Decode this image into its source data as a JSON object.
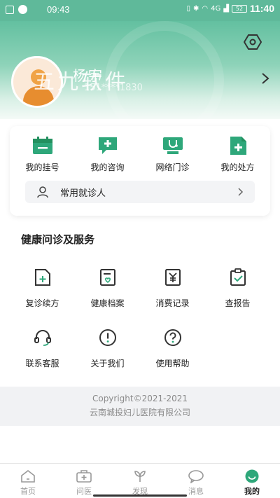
{
  "status_bar": {
    "time_left": "09:43",
    "time_right": "11:40",
    "battery": "52",
    "network": "4G"
  },
  "profile": {
    "name": "杨宇",
    "phone": "151****1830",
    "watermark": "五九软件"
  },
  "quick_actions": [
    {
      "label": "我的挂号",
      "icon": "calendar-icon"
    },
    {
      "label": "我的咨询",
      "icon": "consult-chat-icon"
    },
    {
      "label": "网络门诊",
      "icon": "online-clinic-icon"
    },
    {
      "label": "我的处方",
      "icon": "prescription-icon"
    }
  ],
  "patient_row": {
    "label": "常用就诊人",
    "icon": "person-icon"
  },
  "services": {
    "title": "健康问诊及服务",
    "items": [
      {
        "label": "复诊续方",
        "icon": "revisit-prescription-icon"
      },
      {
        "label": "健康档案",
        "icon": "health-record-icon"
      },
      {
        "label": "消费记录",
        "icon": "payment-record-icon"
      },
      {
        "label": "查报告",
        "icon": "report-icon"
      },
      {
        "label": "联系客服",
        "icon": "headset-icon"
      },
      {
        "label": "关于我们",
        "icon": "info-icon"
      },
      {
        "label": "使用帮助",
        "icon": "help-icon"
      }
    ]
  },
  "footer": {
    "copyright": "Copyright©2021-2021",
    "company": "云南城投妇儿医院有限公司"
  },
  "tabs": [
    {
      "label": "首页",
      "icon": "home-icon",
      "active": false
    },
    {
      "label": "问医",
      "icon": "medical-kit-icon",
      "active": false
    },
    {
      "label": "发现",
      "icon": "discover-icon",
      "active": false
    },
    {
      "label": "消息",
      "icon": "message-icon",
      "active": false
    },
    {
      "label": "我的",
      "icon": "profile-icon",
      "active": true
    }
  ],
  "colors": {
    "brand_green": "#2ea77a",
    "header_green": "#5fb99a",
    "text": "#222222",
    "muted": "#8a8a8a"
  }
}
